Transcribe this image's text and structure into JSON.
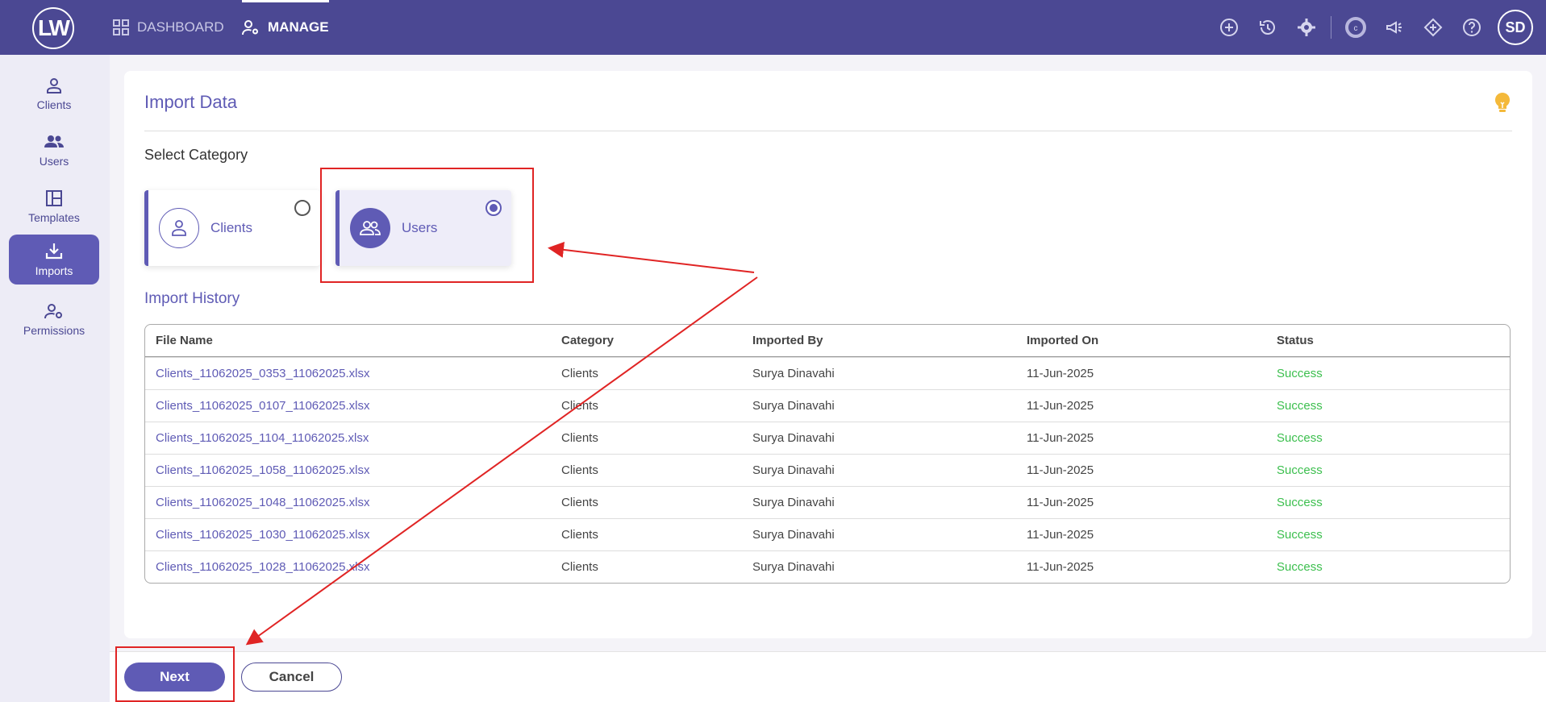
{
  "topbar": {
    "logo": "LW",
    "nav": [
      {
        "label": "DASHBOARD",
        "icon": "grid-icon"
      },
      {
        "label": "MANAGE",
        "icon": "user-gear-icon"
      }
    ],
    "icons": [
      "add-circle-icon",
      "history-icon",
      "settings-icon",
      "c-logo-icon",
      "megaphone-icon",
      "puzzle-icon",
      "help-icon"
    ],
    "avatar": "SD"
  },
  "sidebar": {
    "items": [
      {
        "label": "Clients",
        "icon": "person-icon"
      },
      {
        "label": "Users",
        "icon": "users-icon"
      },
      {
        "label": "Templates",
        "icon": "template-icon"
      },
      {
        "label": "Imports",
        "icon": "import-icon",
        "active": true
      },
      {
        "label": "Permissions",
        "icon": "user-gear-icon"
      }
    ]
  },
  "main": {
    "title": "Import Data",
    "select_category_label": "Select Category",
    "categories": [
      {
        "label": "Clients",
        "selected": false
      },
      {
        "label": "Users",
        "selected": true
      }
    ],
    "import_history_label": "Import History",
    "table": {
      "headers": [
        "File Name",
        "Category",
        "Imported By",
        "Imported On",
        "Status"
      ],
      "rows": [
        [
          "Clients_11062025_0353_11062025.xlsx",
          "Clients",
          "Surya Dinavahi",
          "11-Jun-2025",
          "Success"
        ],
        [
          "Clients_11062025_0107_11062025.xlsx",
          "Clients",
          "Surya Dinavahi",
          "11-Jun-2025",
          "Success"
        ],
        [
          "Clients_11062025_1104_11062025.xlsx",
          "Clients",
          "Surya Dinavahi",
          "11-Jun-2025",
          "Success"
        ],
        [
          "Clients_11062025_1058_11062025.xlsx",
          "Clients",
          "Surya Dinavahi",
          "11-Jun-2025",
          "Success"
        ],
        [
          "Clients_11062025_1048_11062025.xlsx",
          "Clients",
          "Surya Dinavahi",
          "11-Jun-2025",
          "Success"
        ],
        [
          "Clients_11062025_1030_11062025.xlsx",
          "Clients",
          "Surya Dinavahi",
          "11-Jun-2025",
          "Success"
        ],
        [
          "Clients_11062025_1028_11062025.xlsx",
          "Clients",
          "Surya Dinavahi",
          "11-Jun-2025",
          "Success"
        ]
      ]
    }
  },
  "footer": {
    "next_label": "Next",
    "cancel_label": "Cancel"
  },
  "colors": {
    "brand": "#4b4893",
    "accent": "#5f5bb5",
    "success": "#3cbf4e",
    "annotation": "#e02424"
  }
}
